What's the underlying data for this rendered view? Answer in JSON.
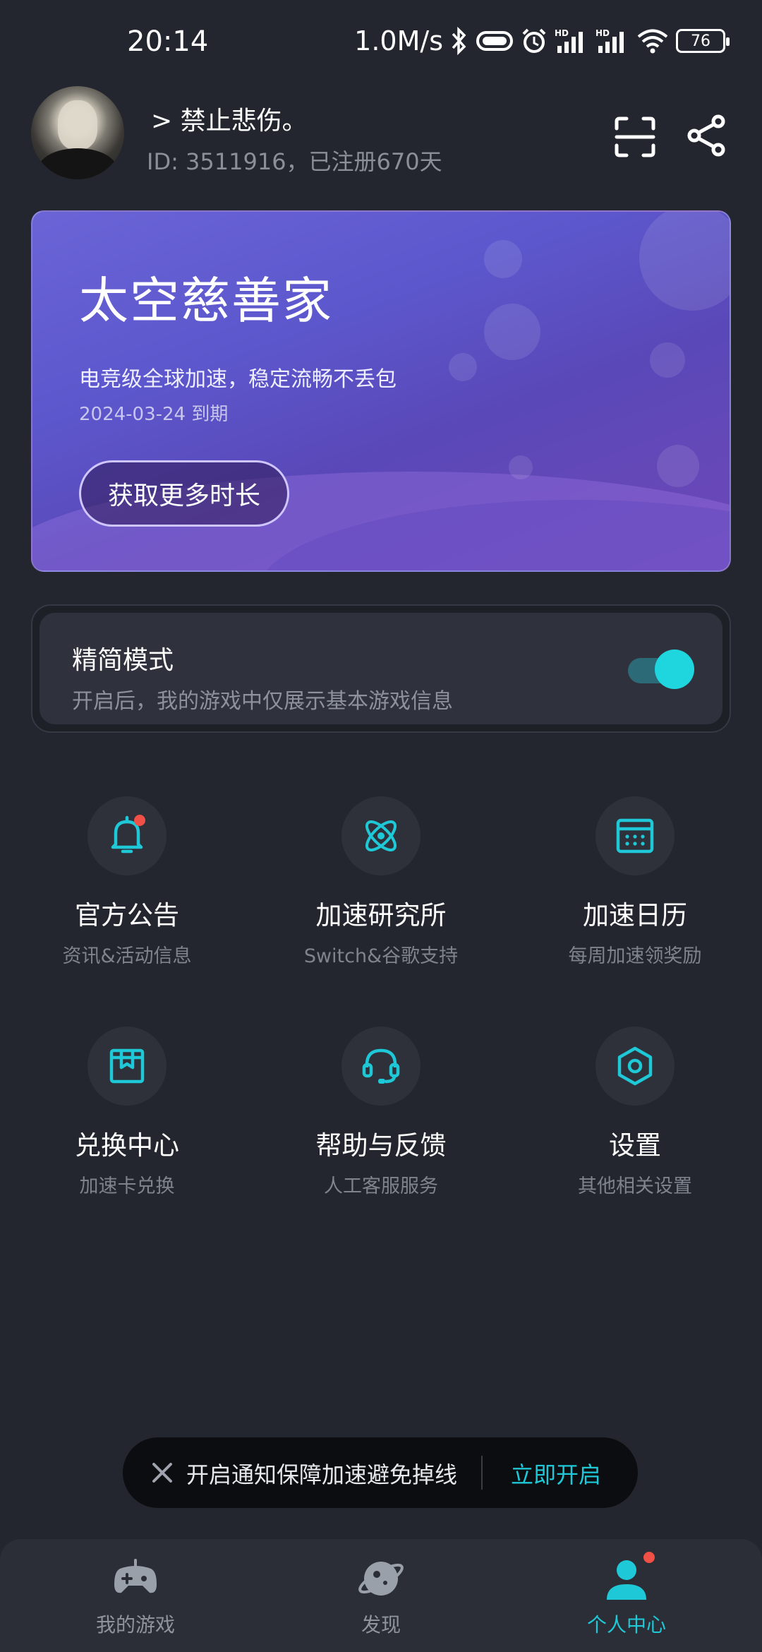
{
  "status_bar": {
    "time": "20:14",
    "network_speed": "1.0M/s",
    "battery": "76",
    "icons": [
      "bluetooth-icon",
      "pill-icon",
      "alarm-icon",
      "signal-hd-icon",
      "signal-hd-icon",
      "wifi-icon",
      "battery-icon"
    ]
  },
  "profile": {
    "nickname": "> 禁止悲伤。",
    "id_line": "ID: 3511916，已注册670天"
  },
  "vip_card": {
    "title": "太空慈善家",
    "subtitle": "电竞级全球加速，稳定流畅不丢包",
    "expire": "2024-03-24 到期",
    "button": "获取更多时长"
  },
  "simple_mode": {
    "title": "精简模式",
    "description": "开启后，我的游戏中仅展示基本游戏信息",
    "enabled": true
  },
  "features": [
    {
      "label": "官方公告",
      "sub": "资讯&活动信息",
      "icon": "bell-icon",
      "badge": true
    },
    {
      "label": "加速研究所",
      "sub": "Switch&谷歌支持",
      "icon": "atom-icon",
      "badge": false
    },
    {
      "label": "加速日历",
      "sub": "每周加速领奖励",
      "icon": "calendar-icon",
      "badge": false
    },
    {
      "label": "兑换中心",
      "sub": "加速卡兑换",
      "icon": "gift-box-icon",
      "badge": false
    },
    {
      "label": "帮助与反馈",
      "sub": "人工客服服务",
      "icon": "headset-icon",
      "badge": false
    },
    {
      "label": "设置",
      "sub": "其他相关设置",
      "icon": "hexagon-gear-icon",
      "badge": false
    }
  ],
  "toast": {
    "text": "开启通知保障加速避免掉线",
    "action": "立即开启"
  },
  "tabs": [
    {
      "label": "我的游戏",
      "icon": "gamepad-icon",
      "active": false
    },
    {
      "label": "发现",
      "icon": "planet-icon",
      "active": false
    },
    {
      "label": "个人中心",
      "icon": "person-icon",
      "active": true
    }
  ],
  "colors": {
    "background": "#23262e",
    "accent": "#1fc8d6",
    "badge": "#f05045",
    "card_start": "#6a64d7",
    "card_end": "#6f47b8"
  }
}
